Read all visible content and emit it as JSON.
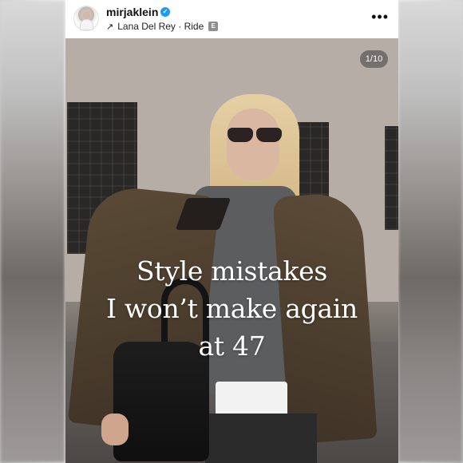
{
  "post": {
    "username": "mirjaklein",
    "verified_badge": "✓",
    "music_arrow": "↗",
    "music_label": "Lana Del Rey · Ride",
    "explicit_badge": "E",
    "more_icon": "•••"
  },
  "media": {
    "counter": "1/10",
    "caption_lines": [
      "Style mistakes",
      "I won’t make again",
      "at 47"
    ]
  }
}
